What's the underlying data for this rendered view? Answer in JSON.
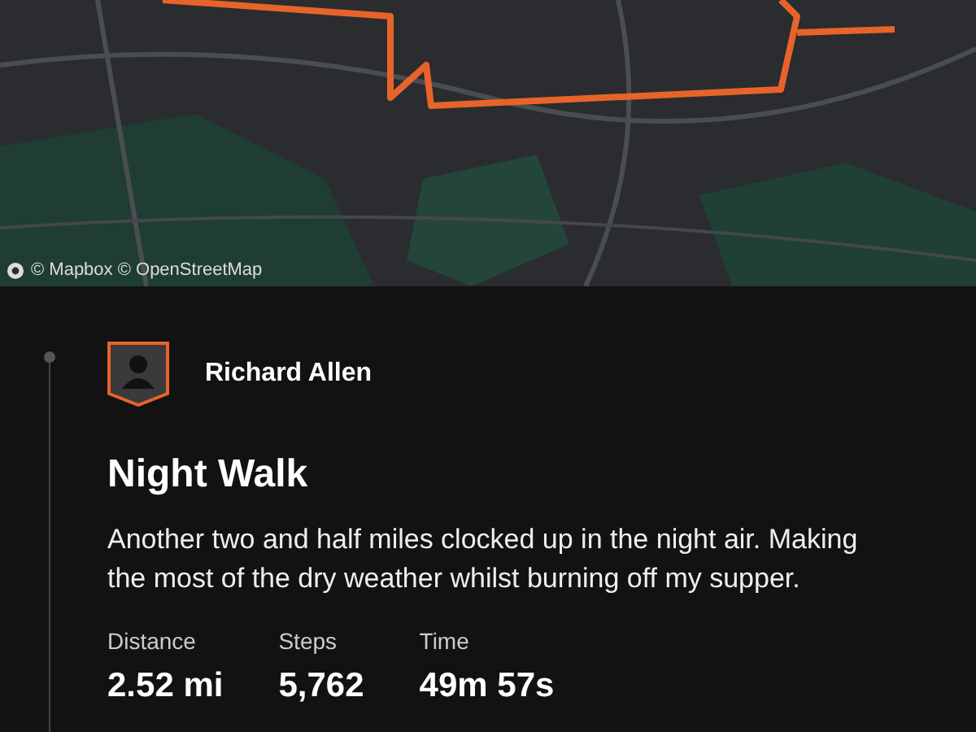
{
  "map": {
    "attribution": "© Mapbox © OpenStreetMap"
  },
  "activity": {
    "athlete": "Richard Allen",
    "title": "Night Walk",
    "description": "Another two and half miles clocked up in the night air. Making the most of the dry weather whilst burning off my supper.",
    "stats": [
      {
        "label": "Distance",
        "value": "2.52 mi"
      },
      {
        "label": "Steps",
        "value": "5,762"
      },
      {
        "label": "Time",
        "value": "49m 57s"
      }
    ]
  }
}
